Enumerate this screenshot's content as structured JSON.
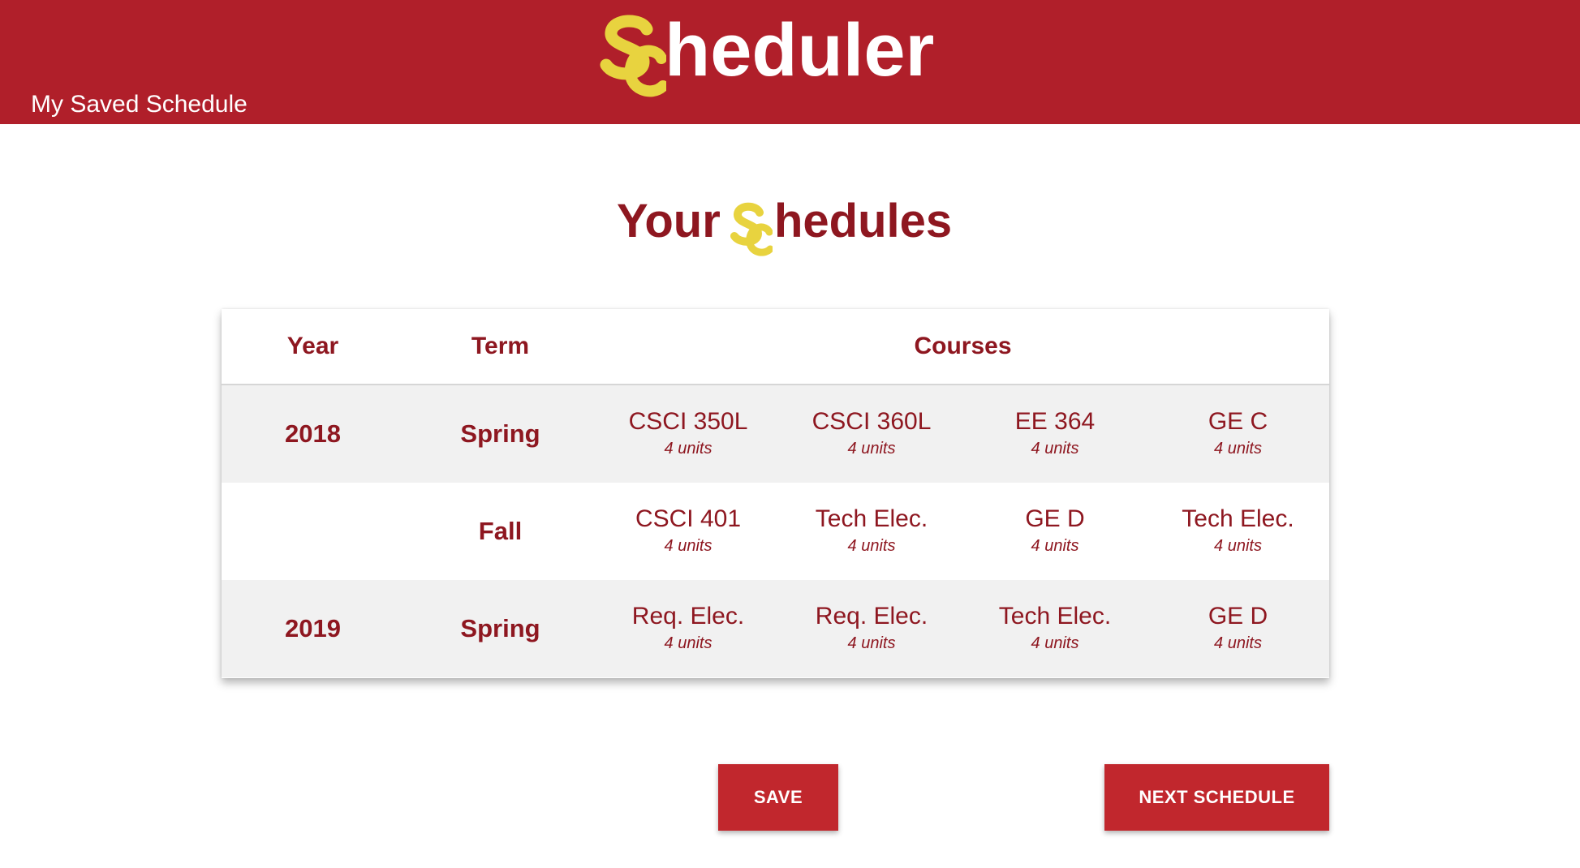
{
  "header": {
    "nav_link": "My Saved Schedule",
    "brand_rest": "heduler",
    "brand_mark_color": "#e8d33f",
    "bar_color": "#b01f2a"
  },
  "main": {
    "heading_word": "Your",
    "heading_rest": "hedules"
  },
  "table": {
    "headers": {
      "year": "Year",
      "term": "Term",
      "courses": "Courses"
    },
    "rows": [
      {
        "year": "2018",
        "term": "Spring",
        "courses": [
          {
            "name": "CSCI 350L",
            "units": "4 units"
          },
          {
            "name": "CSCI 360L",
            "units": "4 units"
          },
          {
            "name": "EE 364",
            "units": "4 units"
          },
          {
            "name": "GE C",
            "units": "4 units"
          }
        ]
      },
      {
        "year": "",
        "term": "Fall",
        "courses": [
          {
            "name": "CSCI 401",
            "units": "4 units"
          },
          {
            "name": "Tech Elec.",
            "units": "4 units"
          },
          {
            "name": "GE D",
            "units": "4 units"
          },
          {
            "name": "Tech Elec.",
            "units": "4 units"
          }
        ]
      },
      {
        "year": "2019",
        "term": "Spring",
        "courses": [
          {
            "name": "Req. Elec.",
            "units": "4 units"
          },
          {
            "name": "Req. Elec.",
            "units": "4 units"
          },
          {
            "name": "Tech Elec.",
            "units": "4 units"
          },
          {
            "name": "GE D",
            "units": "4 units"
          }
        ]
      }
    ]
  },
  "actions": {
    "save_label": "SAVE",
    "next_label": "NEXT SCHEDULE"
  }
}
